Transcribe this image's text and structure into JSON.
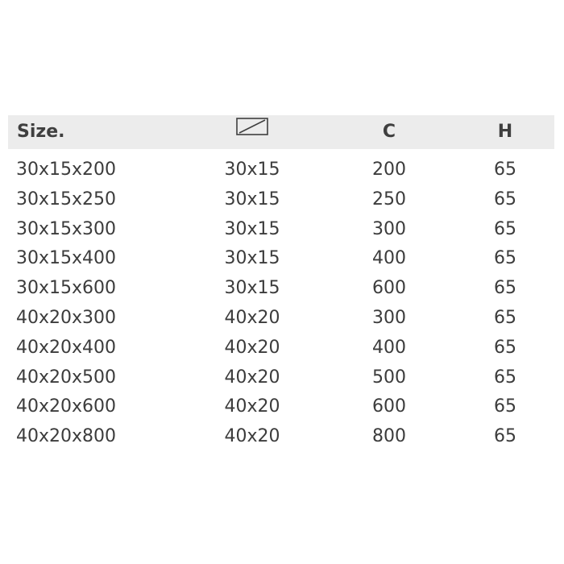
{
  "table": {
    "headers": {
      "size": "Size.",
      "section_icon": "rectangle-section-icon",
      "c": "C",
      "h": "H"
    },
    "rows": [
      {
        "size": "30x15x200",
        "section": "30x15",
        "c": "200",
        "h": "65"
      },
      {
        "size": "30x15x250",
        "section": "30x15",
        "c": "250",
        "h": "65"
      },
      {
        "size": "30x15x300",
        "section": "30x15",
        "c": "300",
        "h": "65"
      },
      {
        "size": "30x15x400",
        "section": "30x15",
        "c": "400",
        "h": "65"
      },
      {
        "size": "30x15x600",
        "section": "30x15",
        "c": "600",
        "h": "65"
      },
      {
        "size": "40x20x300",
        "section": "40x20",
        "c": "300",
        "h": "65"
      },
      {
        "size": "40x20x400",
        "section": "40x20",
        "c": "400",
        "h": "65"
      },
      {
        "size": "40x20x500",
        "section": "40x20",
        "c": "500",
        "h": "65"
      },
      {
        "size": "40x20x600",
        "section": "40x20",
        "c": "600",
        "h": "65"
      },
      {
        "size": "40x20x800",
        "section": "40x20",
        "c": "800",
        "h": "65"
      }
    ]
  },
  "colors": {
    "header_background": "#ececec",
    "text": "#3c3c3c"
  }
}
